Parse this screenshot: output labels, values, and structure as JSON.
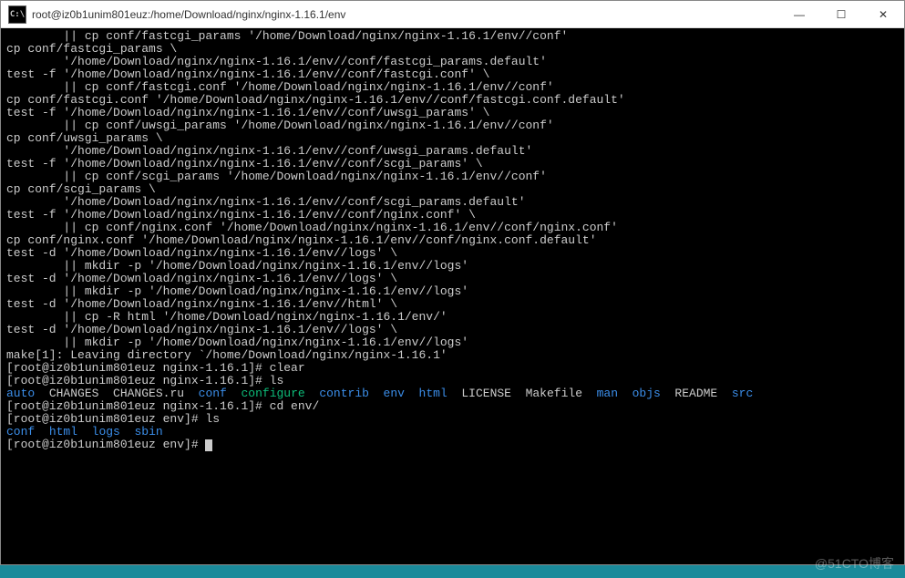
{
  "window": {
    "icon_text": "C:\\",
    "title": "root@iz0b1unim801euz:/home/Download/nginx/nginx-1.16.1/env",
    "min_glyph": "—",
    "max_glyph": "☐",
    "close_glyph": "✕"
  },
  "watermark": "@51CTO博客",
  "terminal_lines": [
    [
      [
        "        || cp conf/fastcgi_params '/home/Download/nginx/nginx-1.16.1/env//conf'",
        "w"
      ]
    ],
    [
      [
        "cp conf/fastcgi_params \\",
        "w"
      ]
    ],
    [
      [
        "        '/home/Download/nginx/nginx-1.16.1/env//conf/fastcgi_params.default'",
        "w"
      ]
    ],
    [
      [
        "test -f '/home/Download/nginx/nginx-1.16.1/env//conf/fastcgi.conf' \\",
        "w"
      ]
    ],
    [
      [
        "        || cp conf/fastcgi.conf '/home/Download/nginx/nginx-1.16.1/env//conf'",
        "w"
      ]
    ],
    [
      [
        "cp conf/fastcgi.conf '/home/Download/nginx/nginx-1.16.1/env//conf/fastcgi.conf.default'",
        "w"
      ]
    ],
    [
      [
        "test -f '/home/Download/nginx/nginx-1.16.1/env//conf/uwsgi_params' \\",
        "w"
      ]
    ],
    [
      [
        "        || cp conf/uwsgi_params '/home/Download/nginx/nginx-1.16.1/env//conf'",
        "w"
      ]
    ],
    [
      [
        "cp conf/uwsgi_params \\",
        "w"
      ]
    ],
    [
      [
        "        '/home/Download/nginx/nginx-1.16.1/env//conf/uwsgi_params.default'",
        "w"
      ]
    ],
    [
      [
        "test -f '/home/Download/nginx/nginx-1.16.1/env//conf/scgi_params' \\",
        "w"
      ]
    ],
    [
      [
        "        || cp conf/scgi_params '/home/Download/nginx/nginx-1.16.1/env//conf'",
        "w"
      ]
    ],
    [
      [
        "cp conf/scgi_params \\",
        "w"
      ]
    ],
    [
      [
        "        '/home/Download/nginx/nginx-1.16.1/env//conf/scgi_params.default'",
        "w"
      ]
    ],
    [
      [
        "test -f '/home/Download/nginx/nginx-1.16.1/env//conf/nginx.conf' \\",
        "w"
      ]
    ],
    [
      [
        "        || cp conf/nginx.conf '/home/Download/nginx/nginx-1.16.1/env//conf/nginx.conf'",
        "w"
      ]
    ],
    [
      [
        "cp conf/nginx.conf '/home/Download/nginx/nginx-1.16.1/env//conf/nginx.conf.default'",
        "w"
      ]
    ],
    [
      [
        "test -d '/home/Download/nginx/nginx-1.16.1/env//logs' \\",
        "w"
      ]
    ],
    [
      [
        "        || mkdir -p '/home/Download/nginx/nginx-1.16.1/env//logs'",
        "w"
      ]
    ],
    [
      [
        "test -d '/home/Download/nginx/nginx-1.16.1/env//logs' \\",
        "w"
      ]
    ],
    [
      [
        "        || mkdir -p '/home/Download/nginx/nginx-1.16.1/env//logs'",
        "w"
      ]
    ],
    [
      [
        "test -d '/home/Download/nginx/nginx-1.16.1/env//html' \\",
        "w"
      ]
    ],
    [
      [
        "        || cp -R html '/home/Download/nginx/nginx-1.16.1/env/'",
        "w"
      ]
    ],
    [
      [
        "test -d '/home/Download/nginx/nginx-1.16.1/env//logs' \\",
        "w"
      ]
    ],
    [
      [
        "        || mkdir -p '/home/Download/nginx/nginx-1.16.1/env//logs'",
        "w"
      ]
    ],
    [
      [
        "make[1]: Leaving directory `/home/Download/nginx/nginx-1.16.1'",
        "w"
      ]
    ],
    [
      [
        "[root@iz0b1unim801euz nginx-1.16.1]# clear",
        "w"
      ]
    ],
    [
      [
        "[root@iz0b1unim801euz nginx-1.16.1]# ls",
        "w"
      ]
    ],
    [
      [
        "auto",
        "b"
      ],
      [
        "  CHANGES  CHANGES.ru  ",
        "w"
      ],
      [
        "conf",
        "b"
      ],
      [
        "  ",
        "w"
      ],
      [
        "configure",
        "g"
      ],
      [
        "  ",
        "w"
      ],
      [
        "contrib",
        "b"
      ],
      [
        "  ",
        "w"
      ],
      [
        "env",
        "b"
      ],
      [
        "  ",
        "w"
      ],
      [
        "html",
        "b"
      ],
      [
        "  LICENSE  Makefile  ",
        "w"
      ],
      [
        "man",
        "b"
      ],
      [
        "  ",
        "w"
      ],
      [
        "objs",
        "b"
      ],
      [
        "  README  ",
        "w"
      ],
      [
        "src",
        "b"
      ]
    ],
    [
      [
        "[root@iz0b1unim801euz nginx-1.16.1]# cd env/",
        "w"
      ]
    ],
    [
      [
        "[root@iz0b1unim801euz env]# ls",
        "w"
      ]
    ],
    [
      [
        "conf",
        "b"
      ],
      [
        "  ",
        "w"
      ],
      [
        "html",
        "b"
      ],
      [
        "  ",
        "w"
      ],
      [
        "logs",
        "b"
      ],
      [
        "  ",
        "w"
      ],
      [
        "sbin",
        "b"
      ]
    ],
    [
      [
        "[root@iz0b1unim801euz env]# ",
        "w"
      ],
      [
        "CURSOR",
        "cur"
      ]
    ]
  ]
}
